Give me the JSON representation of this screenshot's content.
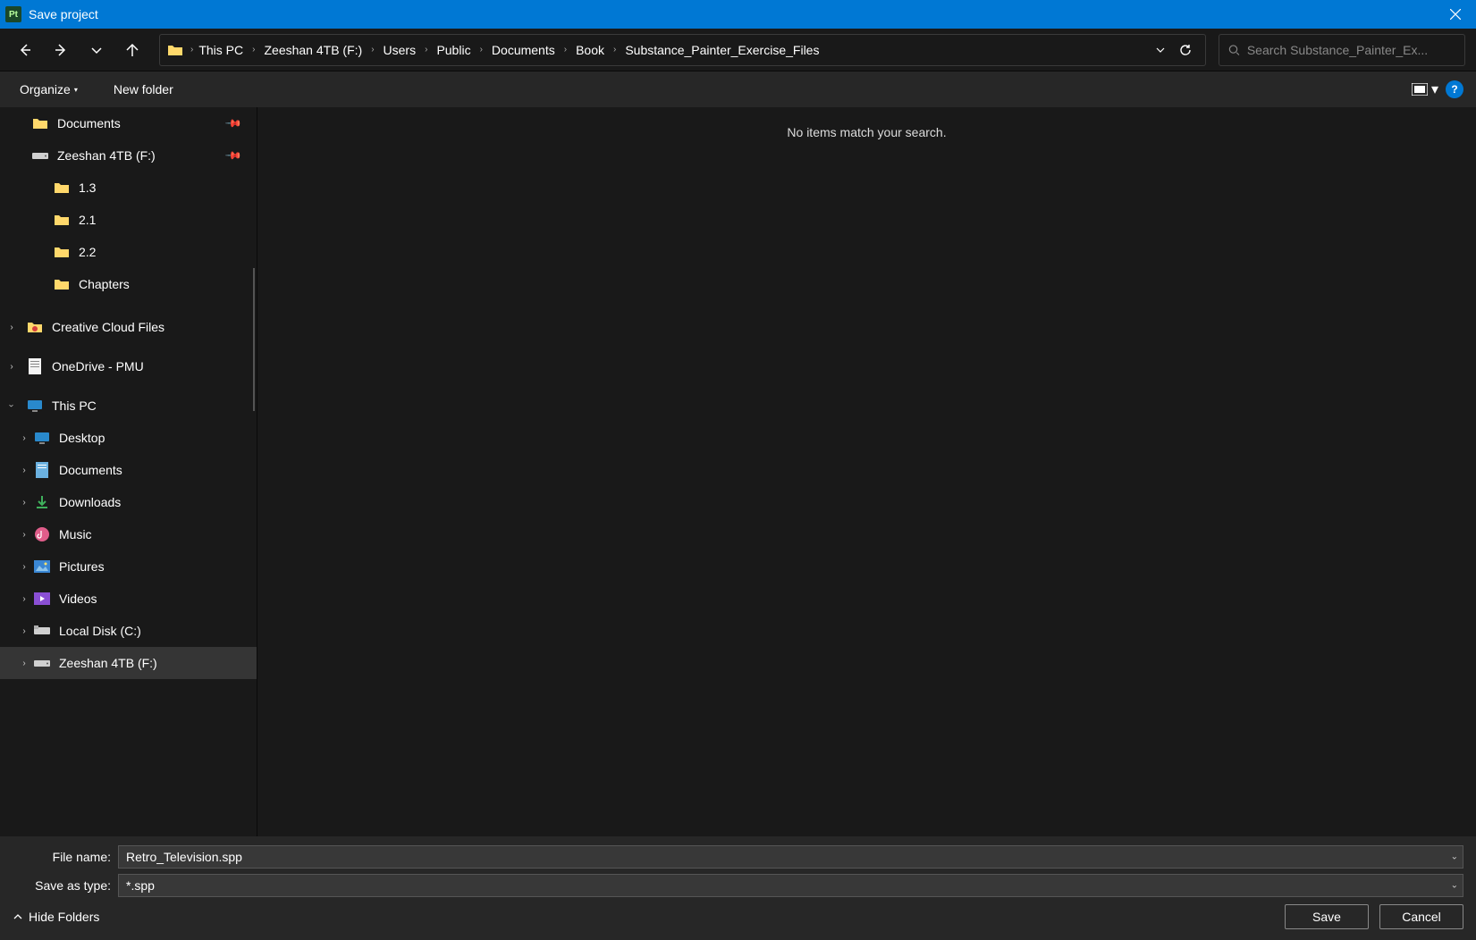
{
  "window": {
    "title": "Save project"
  },
  "breadcrumb": [
    "This PC",
    "Zeeshan 4TB (F:)",
    "Users",
    "Public",
    "Documents",
    "Book",
    "Substance_Painter_Exercise_Files"
  ],
  "search": {
    "placeholder": "Search Substance_Painter_Ex..."
  },
  "toolbar": {
    "organize": "Organize",
    "newfolder": "New folder"
  },
  "sidebar": {
    "quick": [
      {
        "label": "Documents",
        "icon": "folder",
        "pinned": true
      },
      {
        "label": "Zeeshan 4TB (F:)",
        "icon": "drive",
        "pinned": true
      },
      {
        "label": "1.3",
        "icon": "folder"
      },
      {
        "label": "2.1",
        "icon": "folder"
      },
      {
        "label": "2.2",
        "icon": "folder"
      },
      {
        "label": "Chapters",
        "icon": "folder"
      }
    ],
    "cloud": [
      {
        "label": "Creative Cloud Files",
        "icon": "cc"
      },
      {
        "label": "OneDrive - PMU",
        "icon": "file"
      }
    ],
    "thispc": {
      "label": "This PC",
      "expanded": true
    },
    "drives": [
      {
        "label": "Desktop",
        "icon": "desktop"
      },
      {
        "label": "Documents",
        "icon": "documents"
      },
      {
        "label": "Downloads",
        "icon": "downloads"
      },
      {
        "label": "Music",
        "icon": "music"
      },
      {
        "label": "Pictures",
        "icon": "pictures"
      },
      {
        "label": "Videos",
        "icon": "videos"
      },
      {
        "label": "Local Disk (C:)",
        "icon": "disk"
      },
      {
        "label": "Zeeshan 4TB (F:)",
        "icon": "drive",
        "selected": true
      }
    ]
  },
  "content": {
    "empty": "No items match your search."
  },
  "fields": {
    "filename_label": "File name:",
    "filename_value": "Retro_Television.spp",
    "type_label": "Save as type:",
    "type_value": "*.spp"
  },
  "actions": {
    "hide": "Hide Folders",
    "save": "Save",
    "cancel": "Cancel"
  }
}
